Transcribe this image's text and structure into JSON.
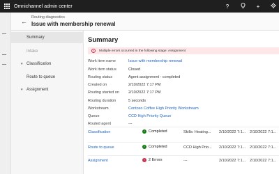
{
  "app": {
    "title": "Omnichannel admin center",
    "waffle_icon": "waffle-icon",
    "top_icons": [
      "help-icon",
      "lightbulb-icon",
      "add-icon",
      "settings-icon"
    ]
  },
  "header": {
    "breadcrumb": "Routing diagnostics",
    "title": "Issue with membership renewal"
  },
  "steps": [
    {
      "label": "Summary",
      "expandable": false,
      "selected": true,
      "dim": false
    },
    {
      "label": "Intake",
      "expandable": false,
      "selected": false,
      "dim": true
    },
    {
      "label": "Classification",
      "expandable": true,
      "selected": false,
      "dim": false
    },
    {
      "label": "Route to queue",
      "expandable": false,
      "selected": false,
      "dim": false
    },
    {
      "label": "Assignment",
      "expandable": true,
      "selected": false,
      "dim": false
    }
  ],
  "summary": {
    "title": "Summary",
    "error_message": "Multiple errors occurred in the following stage: Assignment",
    "fields": [
      {
        "key": "Work item name",
        "value": "Issue with membership renewal",
        "link": true
      },
      {
        "key": "Work item status",
        "value": "Closed",
        "link": false
      },
      {
        "key": "Routing status",
        "value": "Agent assignment - completed",
        "link": false
      },
      {
        "key": "Created on",
        "value": "2/10/2022 7:17 PM",
        "link": false
      },
      {
        "key": "Routing started on",
        "value": "2/10/2022 7:17 PM",
        "link": false
      },
      {
        "key": "Routing duration",
        "value": "5 seconds",
        "link": false
      },
      {
        "key": "Workstream",
        "value": "Contoso Coffee High Priority Workstream",
        "link": true
      },
      {
        "key": "Queue",
        "value": "CCD High Priority Queue",
        "link": true
      },
      {
        "key": "Routed agent",
        "value": "---",
        "link": false
      }
    ],
    "stages": [
      {
        "name": "Classification",
        "status": "Completed",
        "status_type": "ok",
        "detail": "Skills: Heating...",
        "start": "2/10/2022 7:1...",
        "end": "2/10/2022 7:1..."
      },
      {
        "name": "Route to queue",
        "status": "Completed",
        "status_type": "ok",
        "detail": "CCD High Prio...",
        "start": "2/10/2022 7:1...",
        "end": "2/10/2022 7:1..."
      },
      {
        "name": "Assignment",
        "status": "2 Errors",
        "status_type": "bad",
        "detail": "---",
        "start": "2/10/2022 7:1...",
        "end": "2/10/2022 7:1..."
      }
    ]
  }
}
